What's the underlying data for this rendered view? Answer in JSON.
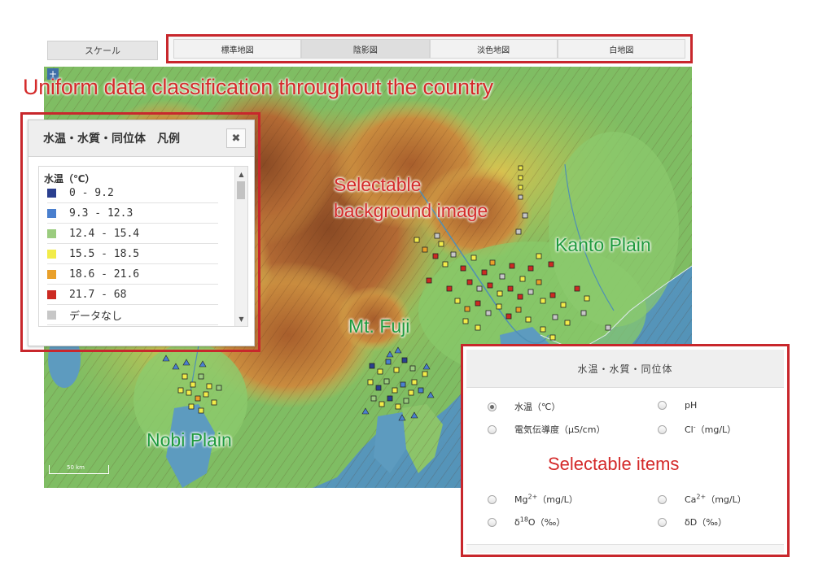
{
  "toolbar": {
    "scale_label": "スケール",
    "tabs": [
      {
        "label": "標準地図",
        "active": false
      },
      {
        "label": "陰影図",
        "active": true
      },
      {
        "label": "淡色地図",
        "active": false
      },
      {
        "label": "白地図",
        "active": false
      }
    ]
  },
  "annotations": {
    "headline": "Uniform data classification throughout the country",
    "background": [
      "Selectable",
      "background image"
    ],
    "kanto": "Kanto Plain",
    "fuji": "Mt. Fuji",
    "nobi": "Nobi Plain",
    "items": "Selectable items"
  },
  "map": {
    "zoom_plus": "+",
    "scale_bar": "50 km"
  },
  "legend": {
    "title": "水温・水質・同位体　凡例",
    "close": "✖",
    "variable": "水温（℃）",
    "classes": [
      {
        "label": "0   -  9.2",
        "color": "#2a3f8f"
      },
      {
        "label": "9.3  -  12.3",
        "color": "#4a7fce"
      },
      {
        "label": "12.4  -  15.4",
        "color": "#9bcc7f"
      },
      {
        "label": "15.5  -  18.5",
        "color": "#f2ec4a"
      },
      {
        "label": "18.6  -  21.6",
        "color": "#e9a02a"
      },
      {
        "label": "21.7  -  68",
        "color": "#cc2a22"
      },
      {
        "label": "データなし",
        "color": "#c7c7c7"
      }
    ],
    "scroll_up": "▲",
    "scroll_down": "▼"
  },
  "items_panel": {
    "title": "水温・水質・同位体",
    "options": {
      "temp": "水温（℃）",
      "ph": "pH",
      "ec": "電気伝導度（μS/cm）",
      "cl": "Cl",
      "cl_sup": "-",
      "cl_unit": "（mg/L）",
      "mg": "Mg",
      "mg_sup": "2+",
      "mg_unit": "（mg/L）",
      "ca": "Ca",
      "ca_sup": "2+",
      "ca_unit": "（mg/L）",
      "d18o_pre": "δ",
      "d18o_sup": "18",
      "d18o_post": "O（‰）",
      "dd": "δD（‰）"
    },
    "selected": "temp"
  }
}
